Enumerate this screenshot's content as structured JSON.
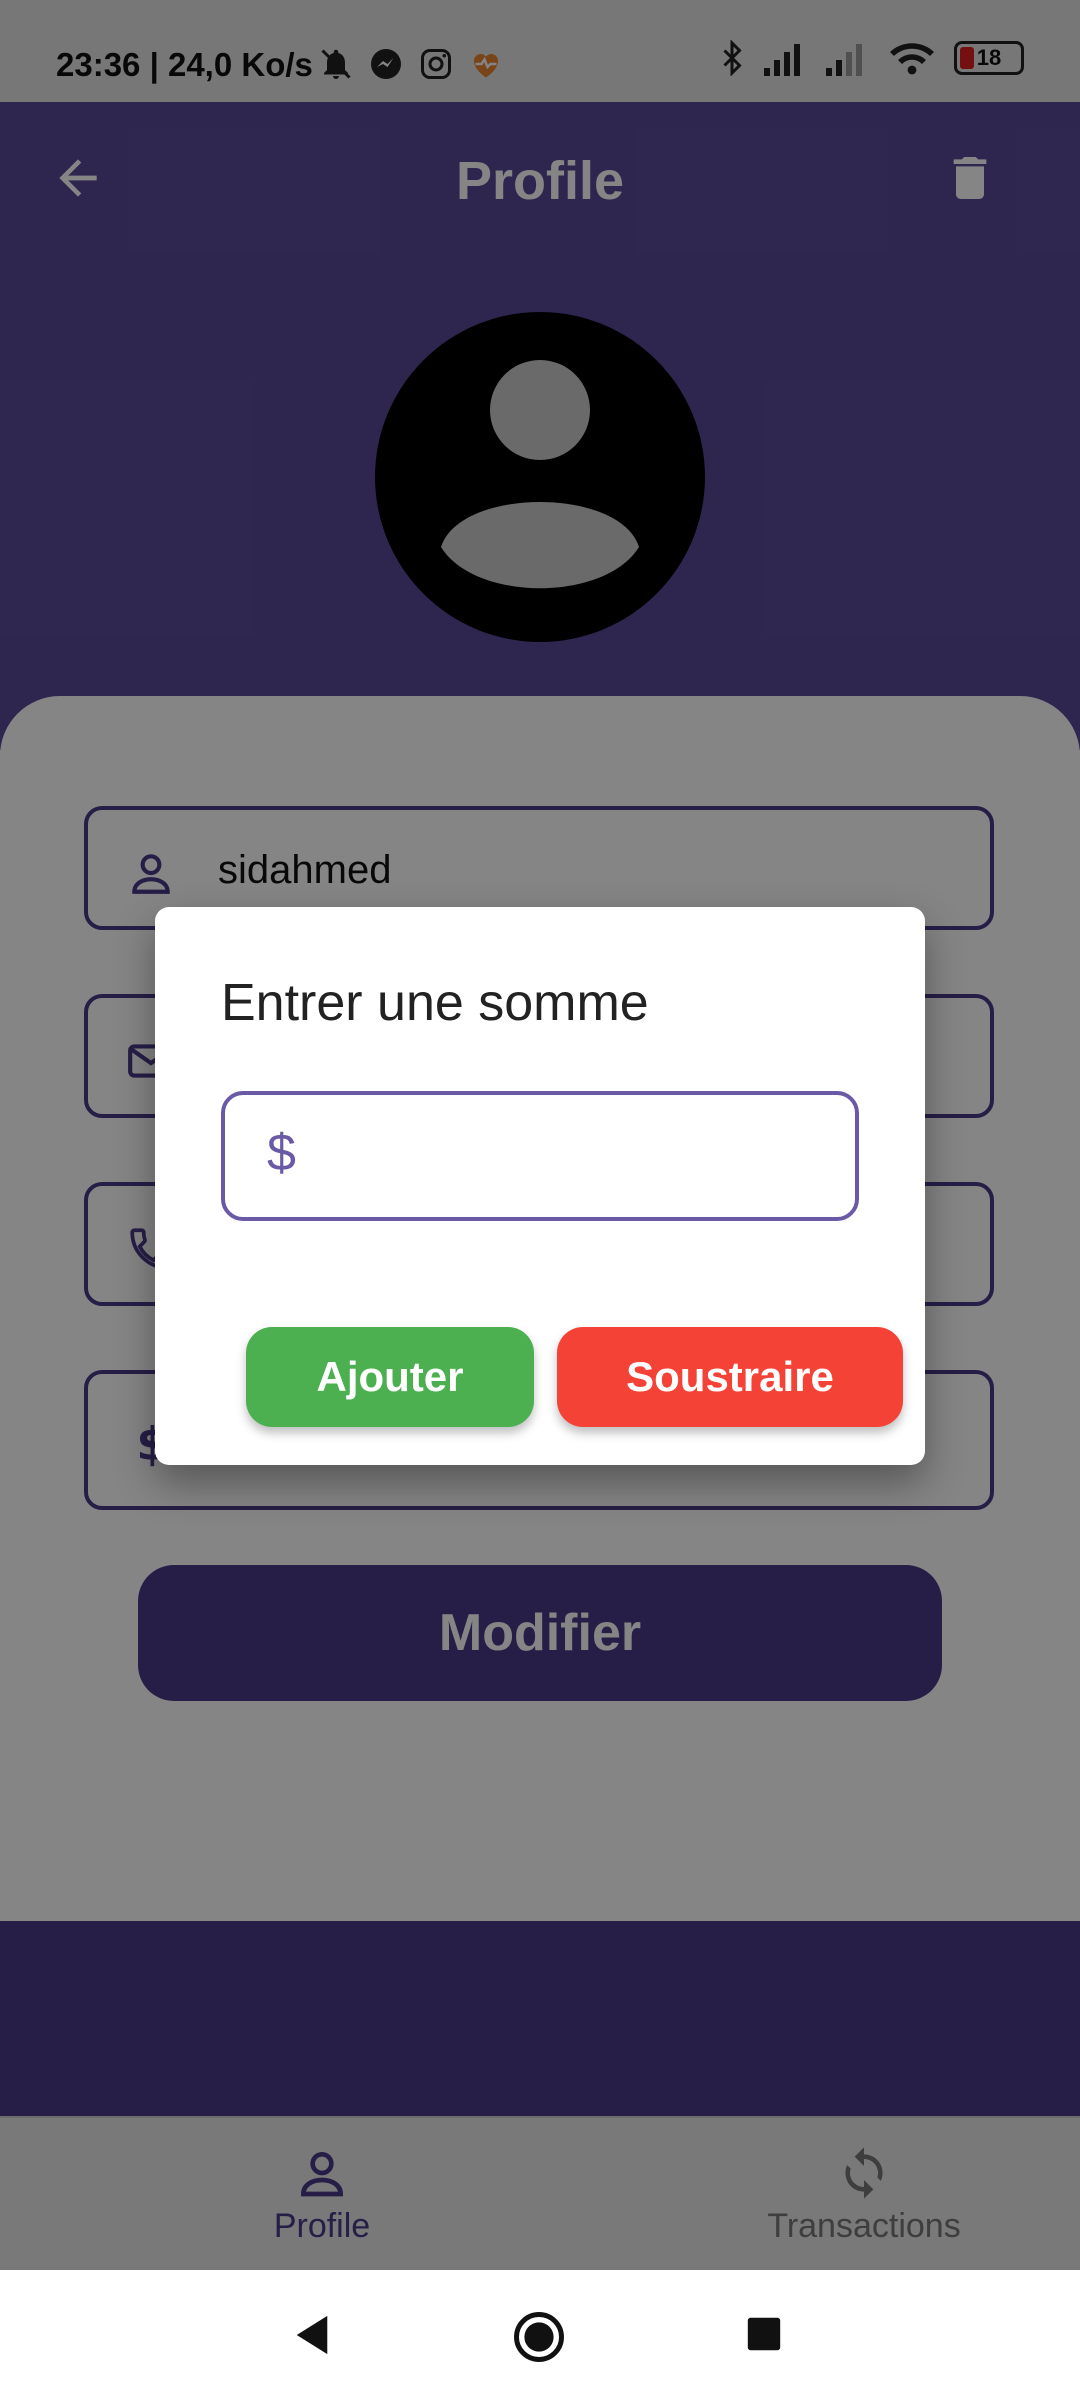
{
  "status_bar": {
    "time_speed": "23:36 | 24,0 Ko/s",
    "battery": "18"
  },
  "app_bar": {
    "title": "Profile"
  },
  "fields": {
    "username": "sidahmed"
  },
  "buttons": {
    "modify": "Modifier"
  },
  "dialog": {
    "title": "Entrer une somme",
    "currency_symbol": "$",
    "amount_value": "",
    "add_label": "Ajouter",
    "subtract_label": "Soustraire"
  },
  "bottom_nav": {
    "items": [
      {
        "label": "Profile"
      },
      {
        "label": "Transactions"
      }
    ]
  },
  "colors": {
    "primary": "#5a4a9a",
    "add": "#4caf50",
    "subtract": "#f44336"
  }
}
